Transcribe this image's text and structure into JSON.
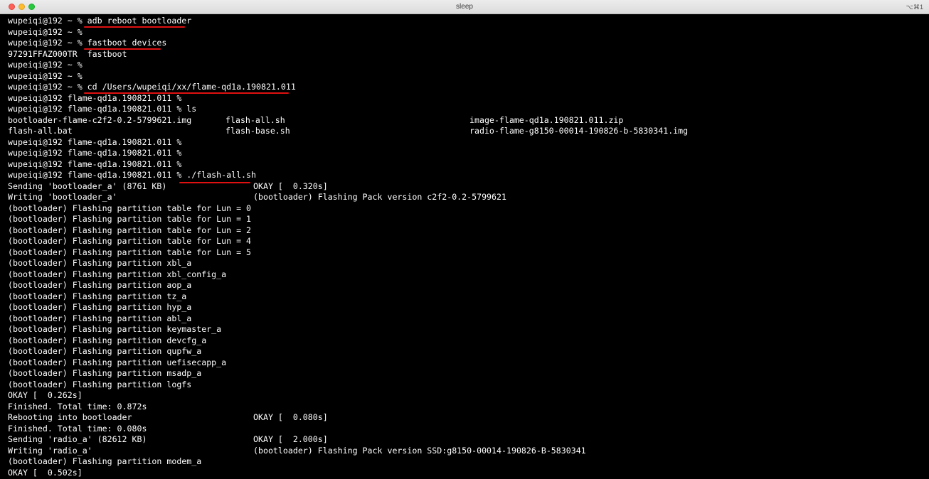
{
  "window": {
    "title": "sleep",
    "shortcut": "⌥⌘1"
  },
  "terminal": {
    "lines": [
      "wupeiqi@192 ~ % adb reboot bootloader",
      "wupeiqi@192 ~ %",
      "wupeiqi@192 ~ % fastboot devices",
      "97291FFAZ000TR  fastboot",
      "wupeiqi@192 ~ %",
      "wupeiqi@192 ~ %",
      "wupeiqi@192 ~ % cd /Users/wupeiqi/xx/flame-qd1a.190821.011",
      "wupeiqi@192 flame-qd1a.190821.011 %",
      "wupeiqi@192 flame-qd1a.190821.011 % ls",
      "bootloader-flame-c2f2-0.2-5799621.img",
      "flash-all.bat",
      "wupeiqi@192 flame-qd1a.190821.011 %",
      "wupeiqi@192 flame-qd1a.190821.011 %",
      "wupeiqi@192 flame-qd1a.190821.011 %",
      "wupeiqi@192 flame-qd1a.190821.011 % ./flash-all.sh",
      "Sending 'bootloader_a' (8761 KB)",
      "Writing 'bootloader_a'",
      "(bootloader) Flashing partition table for Lun = 0",
      "(bootloader) Flashing partition table for Lun = 1",
      "(bootloader) Flashing partition table for Lun = 2",
      "(bootloader) Flashing partition table for Lun = 4",
      "(bootloader) Flashing partition table for Lun = 5",
      "(bootloader) Flashing partition xbl_a",
      "(bootloader) Flashing partition xbl_config_a",
      "(bootloader) Flashing partition aop_a",
      "(bootloader) Flashing partition tz_a",
      "(bootloader) Flashing partition hyp_a",
      "(bootloader) Flashing partition abl_a",
      "(bootloader) Flashing partition keymaster_a",
      "(bootloader) Flashing partition devcfg_a",
      "(bootloader) Flashing partition qupfw_a",
      "(bootloader) Flashing partition uefisecapp_a",
      "(bootloader) Flashing partition msadp_a",
      "(bootloader) Flashing partition logfs",
      "OKAY [  0.262s]",
      "Finished. Total time: 0.872s",
      "Rebooting into bootloader",
      "Finished. Total time: 0.080s",
      "Sending 'radio_a' (82612 KB)",
      "Writing 'radio_a'",
      "(bootloader) Flashing partition modem_a",
      "OKAY [  0.502s]"
    ],
    "col2": {
      "9": "flash-all.sh",
      "10": "flash-base.sh",
      "15": "OKAY [  0.320s]",
      "16": "(bootloader) Flashing Pack version c2f2-0.2-5799621",
      "36": "OKAY [  0.080s]",
      "38": "OKAY [  2.000s]",
      "39": "(bootloader) Flashing Pack version SSD:g8150-00014-190826-B-5830341"
    },
    "col3": {
      "9": "image-flame-qd1a.190821.011.zip",
      "10": "radio-flame-g8150-00014-190826-b-5830341.img"
    }
  },
  "colors": {
    "background": "#000000",
    "text": "#ffffff",
    "annotation": "#e01010"
  }
}
